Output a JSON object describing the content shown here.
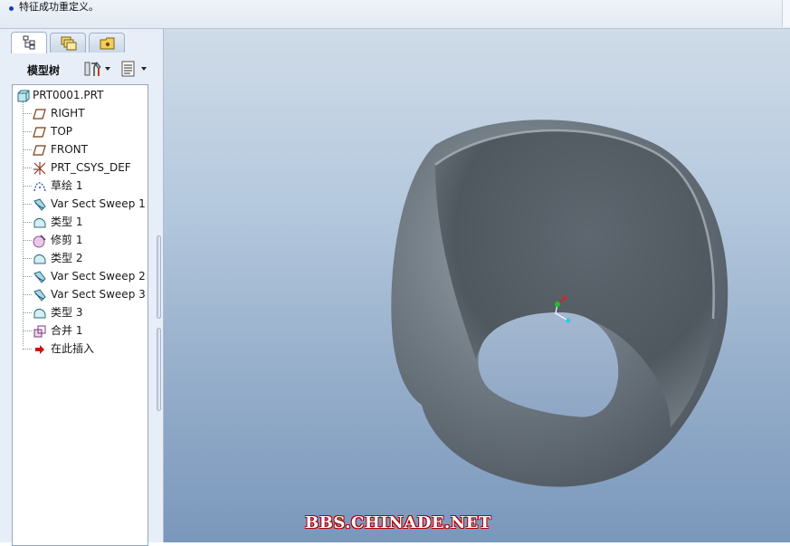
{
  "message_bar": {
    "text": "特征成功重定义。"
  },
  "left_panel": {
    "tabs": [
      {
        "name": "model-tree",
        "icon": "model-tree-icon",
        "active": true
      },
      {
        "name": "layers",
        "icon": "layers-icon",
        "active": false
      },
      {
        "name": "folder-browser",
        "icon": "folder-icon",
        "active": false
      }
    ],
    "tree_title": "模型树",
    "toolbar": {
      "settings_icon": "tree-settings-icon",
      "show_icon": "tree-show-icon"
    },
    "tree_items": [
      {
        "label": "PRT0001.PRT",
        "icon": "part-icon"
      },
      {
        "label": "RIGHT",
        "icon": "datum-plane-icon"
      },
      {
        "label": "TOP",
        "icon": "datum-plane-icon"
      },
      {
        "label": "FRONT",
        "icon": "datum-plane-icon"
      },
      {
        "label": "PRT_CSYS_DEF",
        "icon": "csys-icon"
      },
      {
        "label": "草绘 1",
        "icon": "sketch-icon"
      },
      {
        "label": "Var Sect Sweep 1",
        "icon": "sweep-icon"
      },
      {
        "label": "类型 1",
        "icon": "surface-icon"
      },
      {
        "label": "修剪 1",
        "icon": "trim-icon"
      },
      {
        "label": "类型 2",
        "icon": "surface-icon"
      },
      {
        "label": "Var Sect Sweep 2",
        "icon": "sweep-icon"
      },
      {
        "label": "Var Sect Sweep 3",
        "icon": "sweep-icon"
      },
      {
        "label": "类型 3",
        "icon": "surface-icon"
      },
      {
        "label": "合并 1",
        "icon": "merge-icon"
      },
      {
        "label": "在此插入",
        "icon": "insert-here-arrow-icon"
      }
    ]
  },
  "viewport": {
    "watermark": "BBS.CHINADE.NET",
    "colors": {
      "background_top": "#cfdbe8",
      "background_bottom": "#7a97bb",
      "model": "#6f7880"
    }
  }
}
